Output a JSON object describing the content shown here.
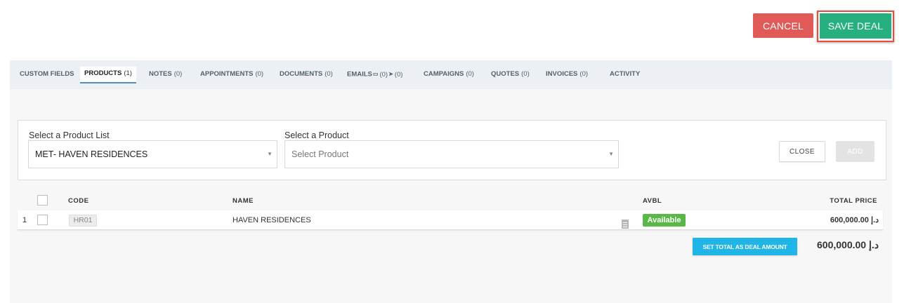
{
  "actions": {
    "cancel_label": "CANCEL",
    "save_label": "SAVE DEAL"
  },
  "tabs": [
    {
      "label": "CUSTOM FIELDS",
      "count": ""
    },
    {
      "label": "PRODUCTS",
      "count": "(1)"
    },
    {
      "label": "NOTES",
      "count": "(0)"
    },
    {
      "label": "APPOINTMENTS",
      "count": "(0)"
    },
    {
      "label": "DOCUMENTS",
      "count": "(0)"
    },
    {
      "label": "EMAILS",
      "count": "(0)",
      "count2": "(0)"
    },
    {
      "label": "CAMPAIGNS",
      "count": "(0)"
    },
    {
      "label": "QUOTES",
      "count": "(0)"
    },
    {
      "label": "INVOICES",
      "count": "(0)"
    },
    {
      "label": "ACTIVITY",
      "count": ""
    }
  ],
  "product_selector": {
    "list_label": "Select a Product List",
    "list_value": "MET- HAVEN RESIDENCES",
    "product_label": "Select a Product",
    "product_placeholder": "Select Product",
    "close_label": "CLOSE",
    "add_label": "ADD"
  },
  "table": {
    "headers": {
      "code": "CODE",
      "name": "NAME",
      "avbl": "AVBL",
      "total_price": "TOTAL PRICE"
    },
    "rows": [
      {
        "index": "1",
        "code": "HR01",
        "name": "HAVEN RESIDENCES",
        "avbl": "Available",
        "total_price": "600,000.00 د.إ"
      }
    ]
  },
  "summary": {
    "set_total_label": "SET TOTAL AS DEAL AMOUNT",
    "grand_total": "600,000.00 د.إ"
  },
  "icons": {
    "emails_sent": "mobile-icon",
    "emails_received": "send-icon",
    "select_caret": "caret-down-icon",
    "row_note": "document-icon"
  },
  "colors": {
    "cancel": "#e05a57",
    "save": "#27b07f",
    "save_outline": "#e74c3c",
    "available_badge": "#58b947",
    "set_total_button": "#1fb5e6",
    "tab_bar": "#ecf0f5"
  }
}
